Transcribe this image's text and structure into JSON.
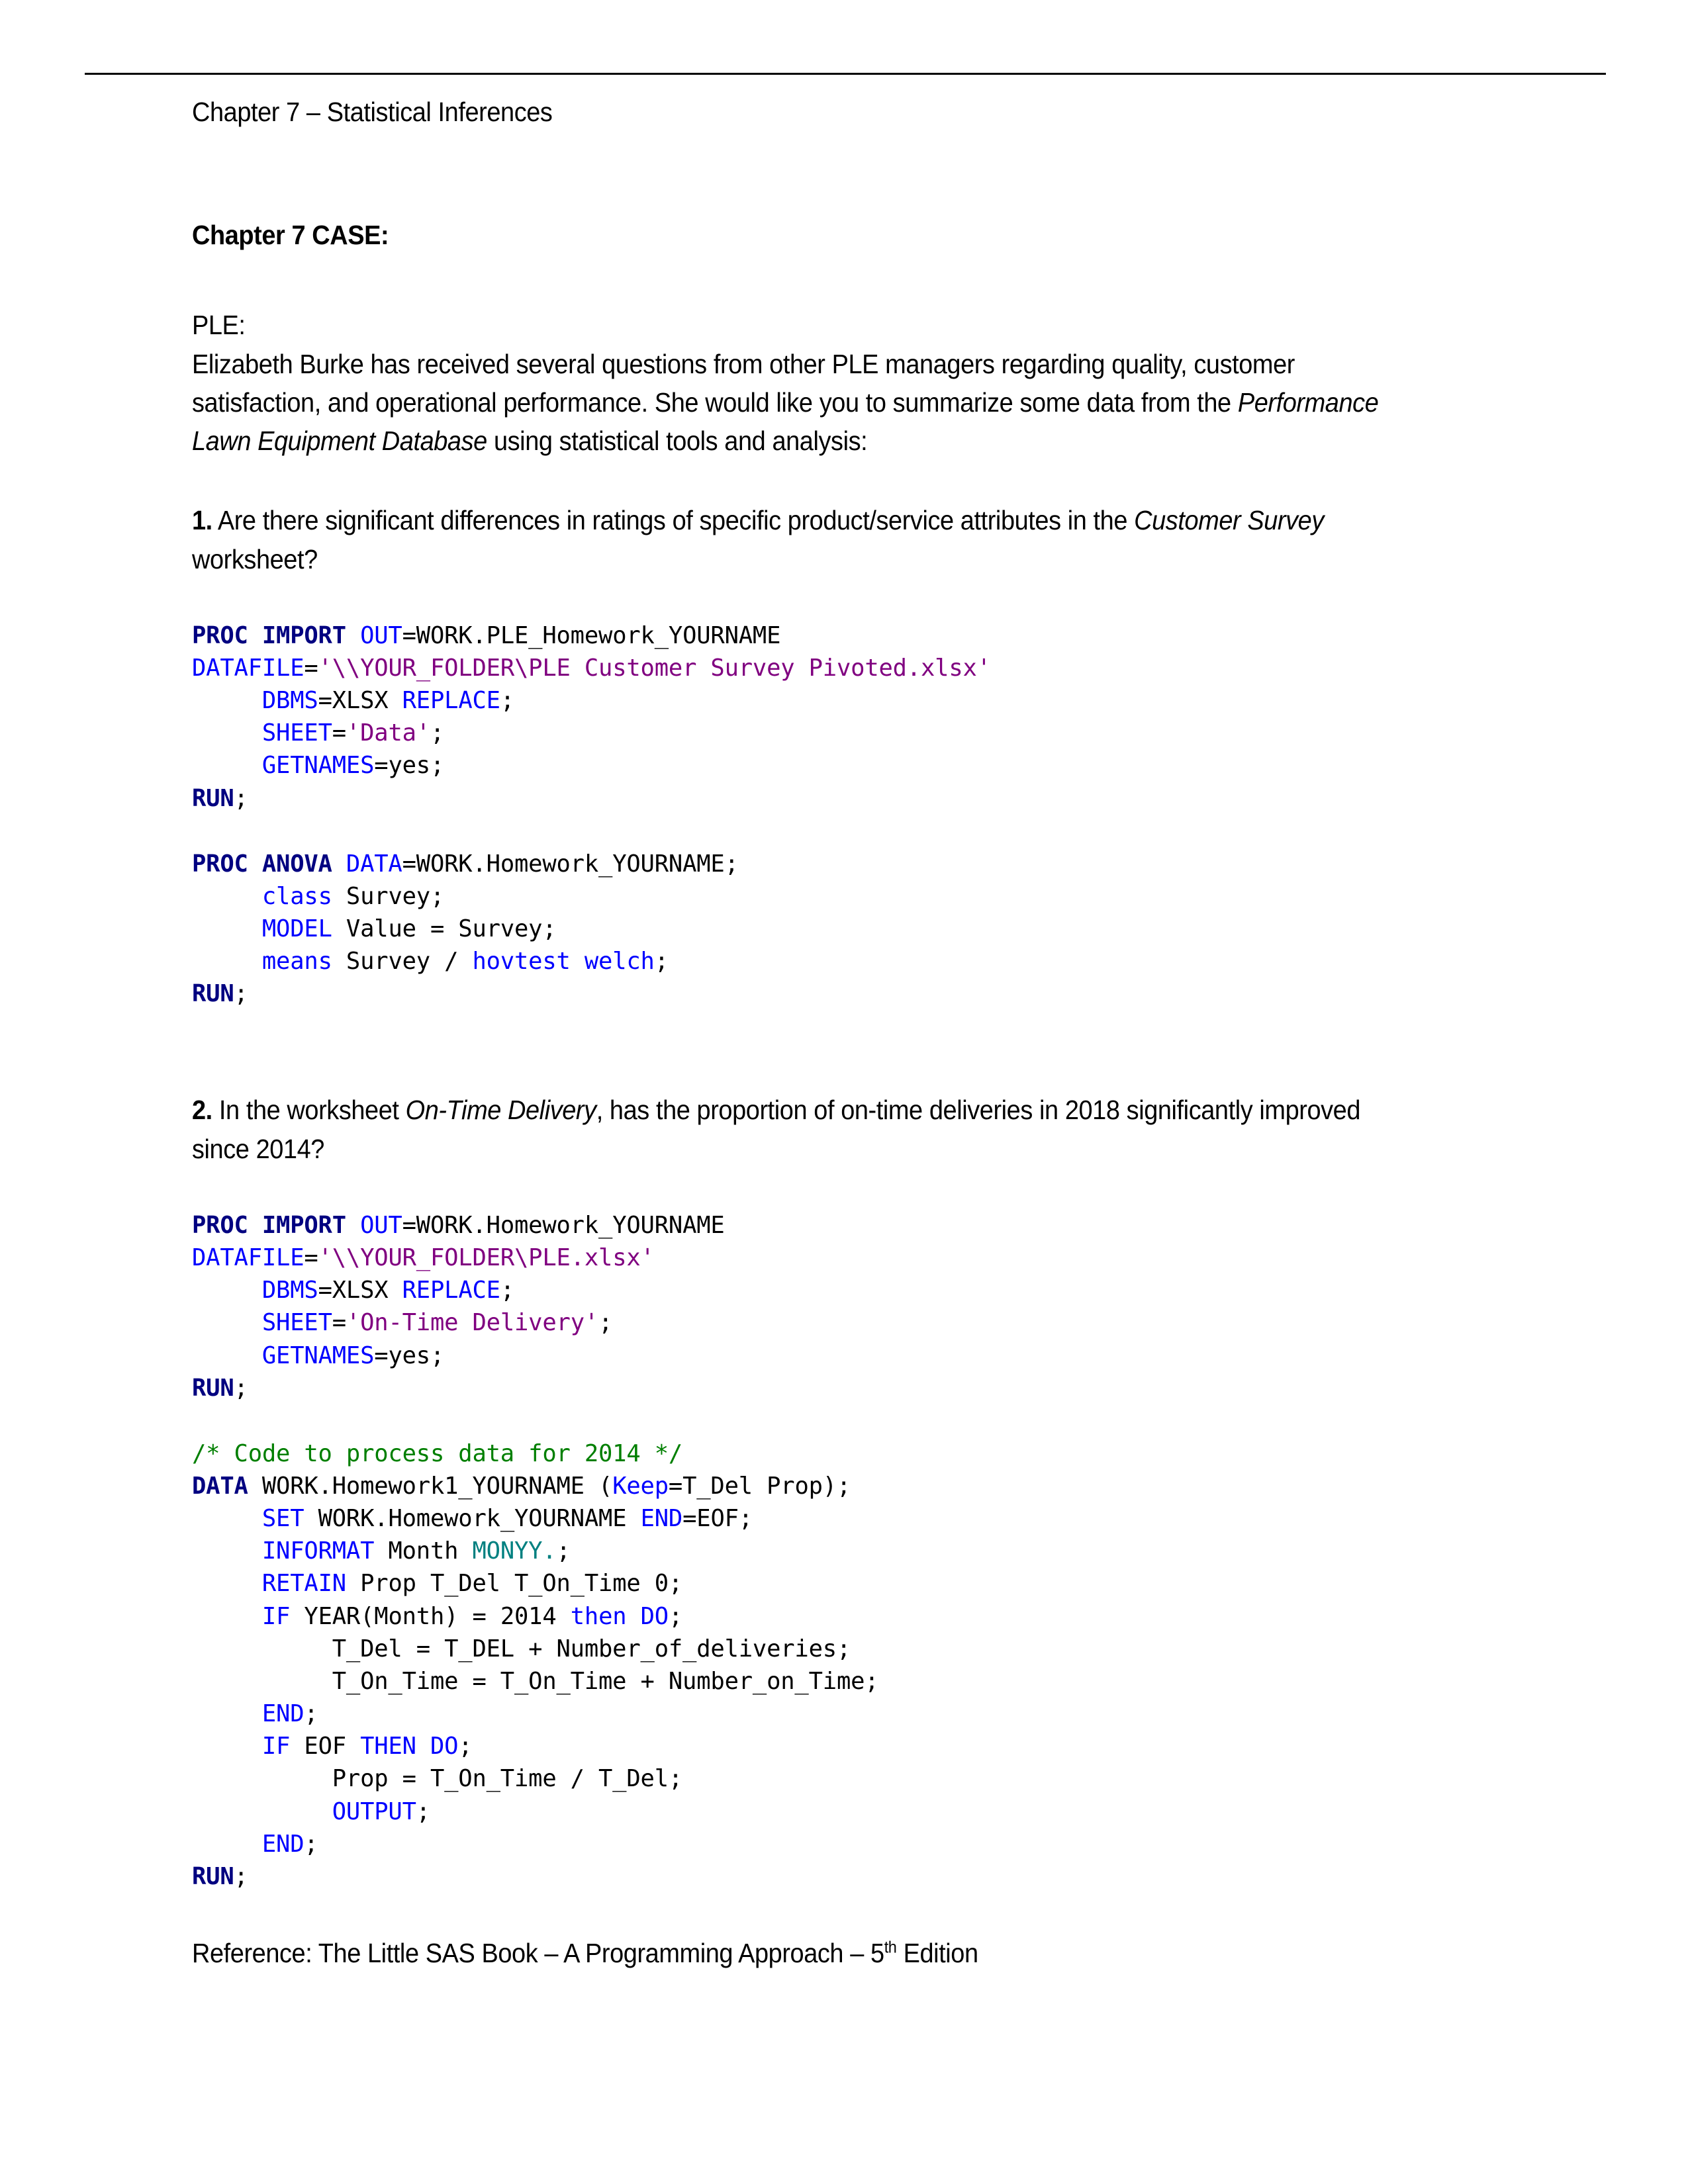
{
  "document": {
    "running_header": "Chapter 7 – Statistical Inferences",
    "title": "Chapter 7 CASE:",
    "intro_label": "PLE:",
    "intro_paragraph": {
      "before_italic": "Elizabeth Burke has received several questions from other PLE managers regarding quality, customer satisfaction, and operational performance. She would like you to summarize some data from the ",
      "italic": "Performance Lawn Equipment Database",
      "after_italic": " using statistical tools and analysis:"
    },
    "questions": [
      {
        "number": "1.",
        "text_before_italic": " Are there significant differences in ratings of specific product/service attributes in the ",
        "italic": "Customer Survey",
        "text_after_italic": " worksheet?"
      },
      {
        "number": "2.",
        "text_before_italic": " In the worksheet ",
        "italic": "On-Time Delivery",
        "text_after_italic": ", has the proportion of on-time deliveries in 2018 significantly improved since 2014?"
      }
    ],
    "reference": {
      "text_before_superscript": "Reference: The Little SAS Book – A Programming Approach – 5",
      "superscript": "th",
      "text_after_superscript": " Edition"
    }
  },
  "code_blocks": [
    {
      "id": "proc-import-customer-survey",
      "lines": [
        [
          {
            "t": "PROC IMPORT ",
            "c": "proc"
          },
          {
            "t": "OUT",
            "c": "kw"
          },
          {
            "t": "=WORK.PLE_Homework_YOURNAME",
            "c": "plain"
          }
        ],
        [
          {
            "t": "DATAFILE",
            "c": "kw"
          },
          {
            "t": "=",
            "c": "plain"
          },
          {
            "t": "'\\\\YOUR_FOLDER\\PLE Customer Survey Pivoted.xlsx'",
            "c": "str"
          }
        ],
        [
          {
            "t": "     ",
            "c": "plain"
          },
          {
            "t": "DBMS",
            "c": "kw"
          },
          {
            "t": "=XLSX ",
            "c": "plain"
          },
          {
            "t": "REPLACE",
            "c": "kw"
          },
          {
            "t": ";",
            "c": "plain"
          }
        ],
        [
          {
            "t": "     ",
            "c": "plain"
          },
          {
            "t": "SHEET",
            "c": "kw"
          },
          {
            "t": "=",
            "c": "plain"
          },
          {
            "t": "'Data'",
            "c": "str"
          },
          {
            "t": ";",
            "c": "plain"
          }
        ],
        [
          {
            "t": "     ",
            "c": "plain"
          },
          {
            "t": "GETNAMES",
            "c": "kw"
          },
          {
            "t": "=yes;",
            "c": "plain"
          }
        ],
        [
          {
            "t": "RUN",
            "c": "proc"
          },
          {
            "t": ";",
            "c": "plain"
          }
        ]
      ]
    },
    {
      "id": "proc-anova",
      "lines": [
        [
          {
            "t": "PROC ANOVA ",
            "c": "proc"
          },
          {
            "t": "DATA",
            "c": "kw"
          },
          {
            "t": "=WORK.Homework_YOURNAME;",
            "c": "plain"
          }
        ],
        [
          {
            "t": "     ",
            "c": "plain"
          },
          {
            "t": "class",
            "c": "kw"
          },
          {
            "t": " Survey;",
            "c": "plain"
          }
        ],
        [
          {
            "t": "     ",
            "c": "plain"
          },
          {
            "t": "MODEL",
            "c": "kw"
          },
          {
            "t": " Value = Survey;",
            "c": "plain"
          }
        ],
        [
          {
            "t": "     ",
            "c": "plain"
          },
          {
            "t": "means",
            "c": "kw"
          },
          {
            "t": " Survey / ",
            "c": "plain"
          },
          {
            "t": "hovtest welch",
            "c": "kw"
          },
          {
            "t": ";",
            "c": "plain"
          }
        ],
        [
          {
            "t": "RUN",
            "c": "proc"
          },
          {
            "t": ";",
            "c": "plain"
          }
        ]
      ]
    },
    {
      "id": "proc-import-on-time-delivery",
      "lines": [
        [
          {
            "t": "PROC IMPORT ",
            "c": "proc"
          },
          {
            "t": "OUT",
            "c": "kw"
          },
          {
            "t": "=WORK.Homework_YOURNAME",
            "c": "plain"
          }
        ],
        [
          {
            "t": "DATAFILE",
            "c": "kw"
          },
          {
            "t": "=",
            "c": "plain"
          },
          {
            "t": "'\\\\YOUR_FOLDER\\PLE.xlsx'",
            "c": "str"
          }
        ],
        [
          {
            "t": "     ",
            "c": "plain"
          },
          {
            "t": "DBMS",
            "c": "kw"
          },
          {
            "t": "=XLSX ",
            "c": "plain"
          },
          {
            "t": "REPLACE",
            "c": "kw"
          },
          {
            "t": ";",
            "c": "plain"
          }
        ],
        [
          {
            "t": "     ",
            "c": "plain"
          },
          {
            "t": "SHEET",
            "c": "kw"
          },
          {
            "t": "=",
            "c": "plain"
          },
          {
            "t": "'On-Time Delivery'",
            "c": "str"
          },
          {
            "t": ";",
            "c": "plain"
          }
        ],
        [
          {
            "t": "     ",
            "c": "plain"
          },
          {
            "t": "GETNAMES",
            "c": "kw"
          },
          {
            "t": "=yes;",
            "c": "plain"
          }
        ],
        [
          {
            "t": "RUN",
            "c": "proc"
          },
          {
            "t": ";",
            "c": "plain"
          }
        ]
      ]
    },
    {
      "id": "data-step-2014",
      "lines": [
        [
          {
            "t": "/* Code to process data for 2014 */",
            "c": "cmt"
          }
        ],
        [
          {
            "t": "DATA",
            "c": "proc"
          },
          {
            "t": " WORK.Homework1_YOURNAME (",
            "c": "plain"
          },
          {
            "t": "Keep",
            "c": "kw"
          },
          {
            "t": "=T_Del Prop);",
            "c": "plain"
          }
        ],
        [
          {
            "t": "     ",
            "c": "plain"
          },
          {
            "t": "SET",
            "c": "kw"
          },
          {
            "t": " WORK.Homework_YOURNAME ",
            "c": "plain"
          },
          {
            "t": "END",
            "c": "kw"
          },
          {
            "t": "=EOF;",
            "c": "plain"
          }
        ],
        [
          {
            "t": "     ",
            "c": "plain"
          },
          {
            "t": "INFORMAT",
            "c": "kw"
          },
          {
            "t": " Month ",
            "c": "plain"
          },
          {
            "t": "MONYY.",
            "c": "fmt"
          },
          {
            "t": ";",
            "c": "plain"
          }
        ],
        [
          {
            "t": "     ",
            "c": "plain"
          },
          {
            "t": "RETAIN",
            "c": "kw"
          },
          {
            "t": " Prop T_Del T_On_Time ",
            "c": "plain"
          },
          {
            "t": "0",
            "c": "num"
          },
          {
            "t": ";",
            "c": "plain"
          }
        ],
        [
          {
            "t": "     ",
            "c": "plain"
          },
          {
            "t": "IF",
            "c": "kw"
          },
          {
            "t": " YEAR(Month) = ",
            "c": "plain"
          },
          {
            "t": "2014",
            "c": "num"
          },
          {
            "t": " ",
            "c": "plain"
          },
          {
            "t": "then DO",
            "c": "kw"
          },
          {
            "t": ";",
            "c": "plain"
          }
        ],
        [
          {
            "t": "          T_Del = T_DEL + Number_of_deliveries;",
            "c": "plain"
          }
        ],
        [
          {
            "t": "          T_On_Time = T_On_Time + Number_on_Time;",
            "c": "plain"
          }
        ],
        [
          {
            "t": "     ",
            "c": "plain"
          },
          {
            "t": "END",
            "c": "kw"
          },
          {
            "t": ";",
            "c": "plain"
          }
        ],
        [
          {
            "t": "     ",
            "c": "plain"
          },
          {
            "t": "IF",
            "c": "kw"
          },
          {
            "t": " EOF ",
            "c": "plain"
          },
          {
            "t": "THEN DO",
            "c": "kw"
          },
          {
            "t": ";",
            "c": "plain"
          }
        ],
        [
          {
            "t": "          Prop = T_On_Time / T_Del;",
            "c": "plain"
          }
        ],
        [
          {
            "t": "          ",
            "c": "plain"
          },
          {
            "t": "OUTPUT",
            "c": "kw"
          },
          {
            "t": ";",
            "c": "plain"
          }
        ],
        [
          {
            "t": "     ",
            "c": "plain"
          },
          {
            "t": "END",
            "c": "kw"
          },
          {
            "t": ";",
            "c": "plain"
          }
        ],
        [
          {
            "t": "RUN",
            "c": "proc"
          },
          {
            "t": ";",
            "c": "plain"
          }
        ]
      ]
    }
  ],
  "colors": {
    "keyword": "#0000FF",
    "proc": "#000080",
    "string": "#800080",
    "comment": "#007F00",
    "number": "#008080",
    "plain": "#000000",
    "rule": "#000000"
  }
}
